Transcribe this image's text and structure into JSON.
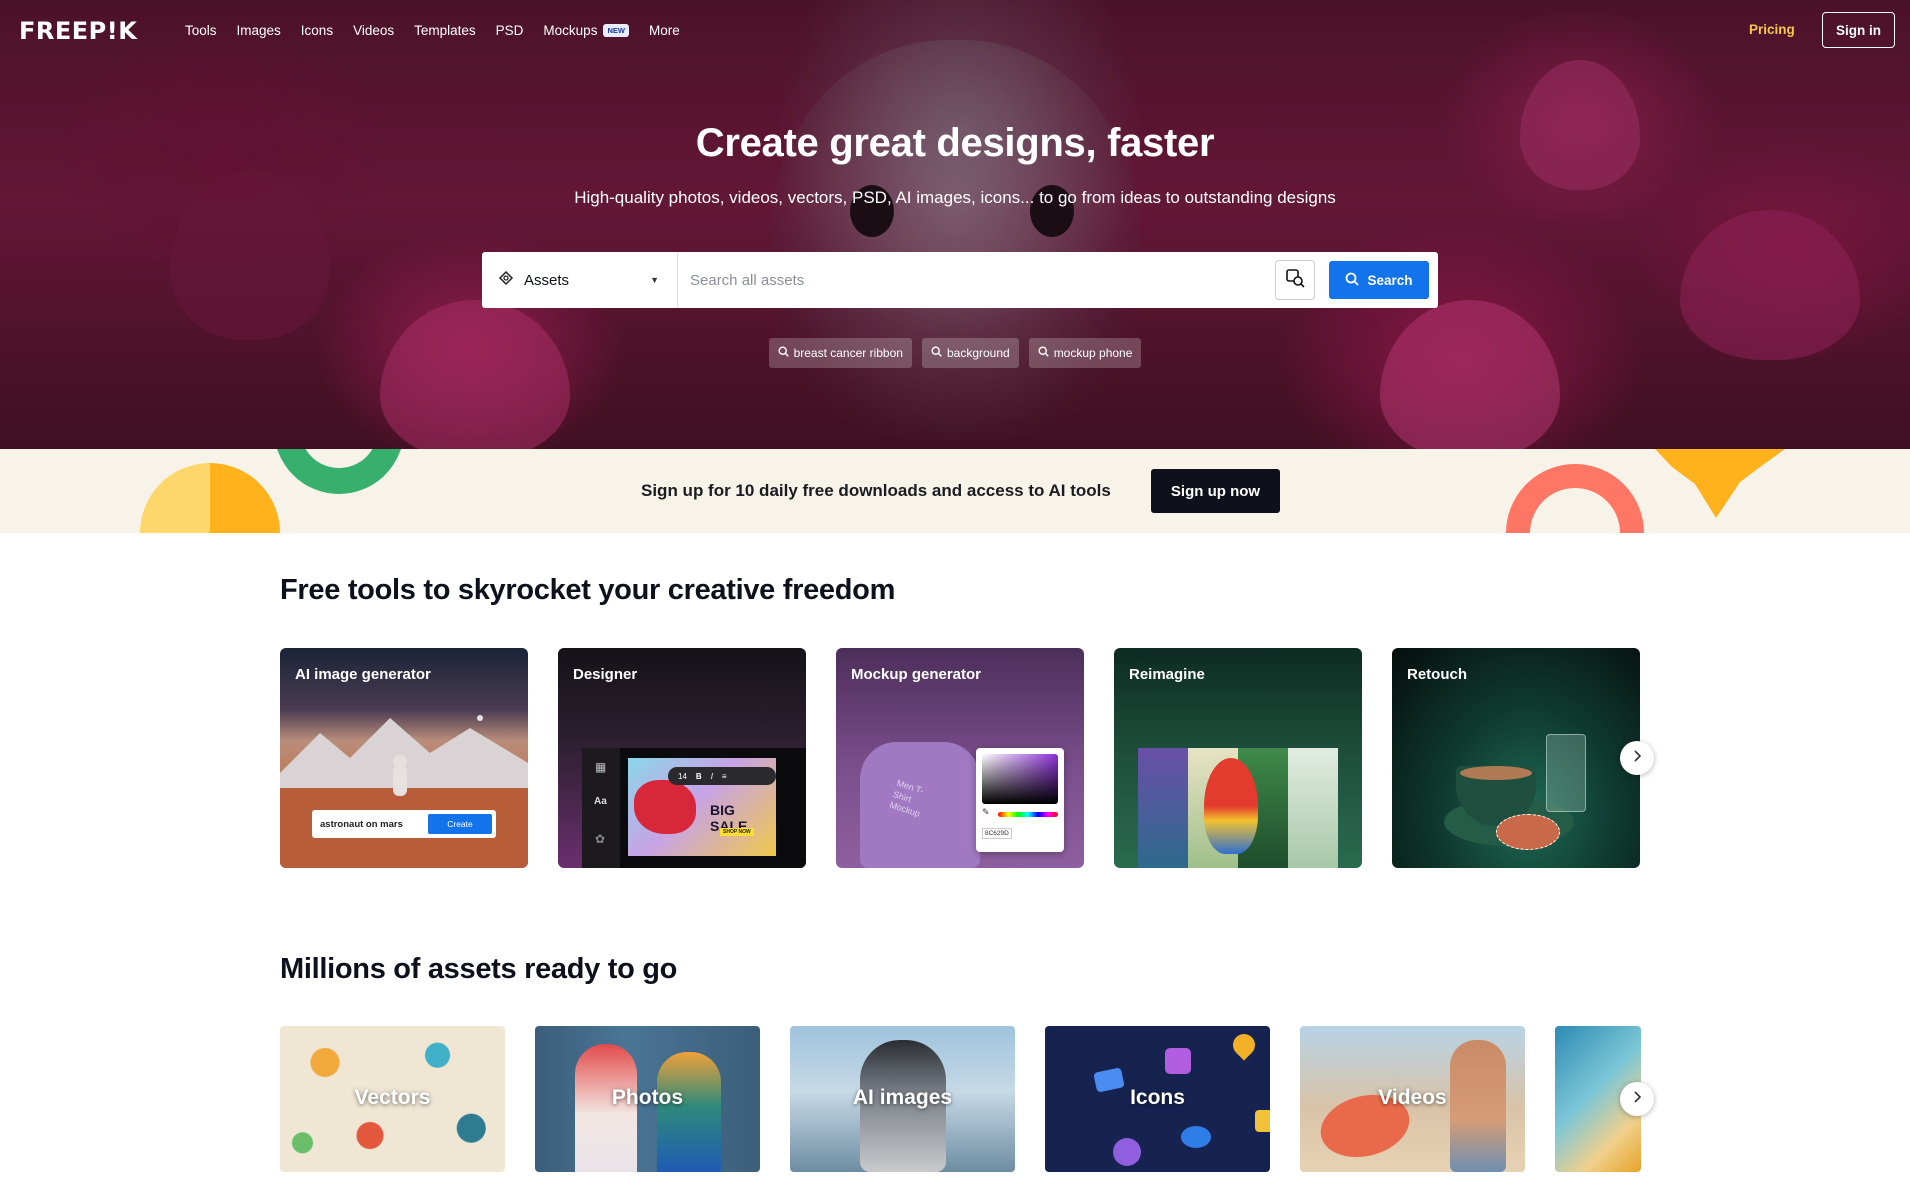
{
  "nav": {
    "logo": "FREEP!K",
    "links": [
      "Tools",
      "Images",
      "Icons",
      "Videos",
      "Templates",
      "PSD",
      "Mockups",
      "More"
    ],
    "mockups_badge": "NEW",
    "pricing": "Pricing",
    "signin": "Sign in"
  },
  "hero": {
    "title": "Create great designs, faster",
    "subtitle": "High-quality photos, videos, vectors, PSD, AI images, icons... to go from ideas to outstanding designs",
    "search": {
      "asset_type": "Assets",
      "placeholder": "Search all assets",
      "button": "Search"
    },
    "suggestions": [
      "breast cancer ribbon",
      "background",
      "mockup phone"
    ]
  },
  "banner": {
    "text": "Sign up for 10 daily free downloads and access to AI tools",
    "button": "Sign up now"
  },
  "tools": {
    "title": "Free tools to skyrocket your creative freedom",
    "cards": [
      {
        "label": "AI image generator",
        "prompt": "astronaut on mars",
        "create": "Create"
      },
      {
        "label": "Designer",
        "font_size": "14",
        "banner": "BIG SALE",
        "shop": "SHOP NOW"
      },
      {
        "label": "Mockup generator",
        "shirt_text": "Men T-Shirt Mockup",
        "hex": "8C629D"
      },
      {
        "label": "Reimagine"
      },
      {
        "label": "Retouch"
      }
    ]
  },
  "assets": {
    "title": "Millions of assets ready to go",
    "cards": [
      "Vectors",
      "Photos",
      "AI images",
      "Icons",
      "Videos"
    ]
  },
  "colors": {
    "accent": "#1273eb",
    "pricing": "#f5c84a",
    "banner_bg": "#f7f3e9"
  }
}
